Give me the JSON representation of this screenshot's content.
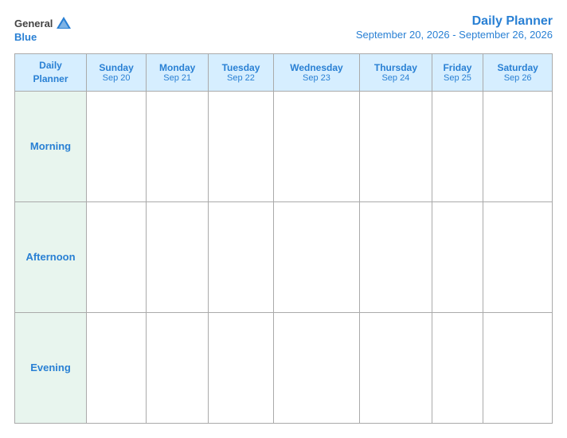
{
  "logo": {
    "general": "General",
    "blue": "Blue"
  },
  "title": {
    "main": "Daily Planner",
    "date_range": "September 20, 2026 - September 26, 2026"
  },
  "header_row": {
    "label": "Daily\nPlanner",
    "days": [
      {
        "name": "Sunday",
        "date": "Sep 20"
      },
      {
        "name": "Monday",
        "date": "Sep 21"
      },
      {
        "name": "Tuesday",
        "date": "Sep 22"
      },
      {
        "name": "Wednesday",
        "date": "Sep 23"
      },
      {
        "name": "Thursday",
        "date": "Sep 24"
      },
      {
        "name": "Friday",
        "date": "Sep 25"
      },
      {
        "name": "Saturday",
        "date": "Sep 26"
      }
    ]
  },
  "rows": [
    {
      "label": "Morning"
    },
    {
      "label": "Afternoon"
    },
    {
      "label": "Evening"
    }
  ]
}
